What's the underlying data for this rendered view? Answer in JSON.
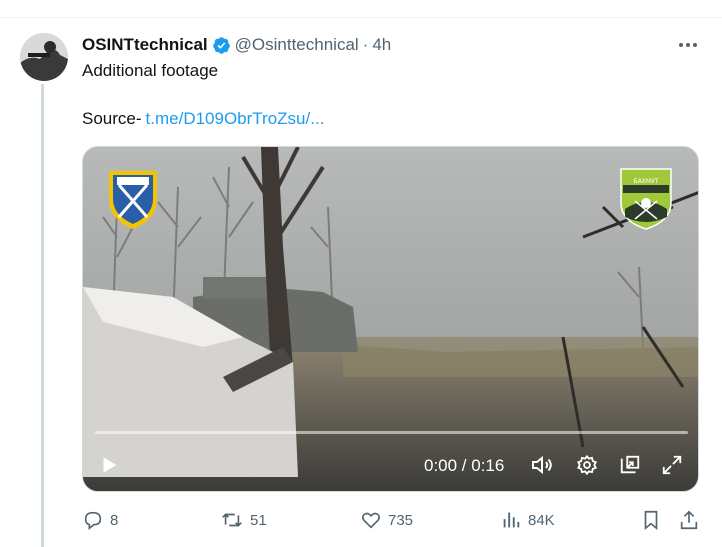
{
  "tweet": {
    "display_name": "OSINTtechnical",
    "handle": "@Osinttechnical",
    "separator": "·",
    "time": "4h",
    "text": "Additional footage",
    "source_label": "Source-",
    "source_link": "t.me/D109ObrTroZsu/...",
    "verified_color": "#1d9bf0"
  },
  "media": {
    "timecode": "0:00 / 0:16",
    "badge_right_text": "БАХМУТ"
  },
  "actions": {
    "replies": "8",
    "reposts": "51",
    "likes": "735",
    "views": "84K"
  },
  "icons": {
    "verified": "verified-badge-icon",
    "more": "more-dots-icon",
    "play": "play-icon",
    "volume": "volume-icon",
    "settings": "gear-icon",
    "popout": "popout-icon",
    "fullscreen": "fullscreen-icon",
    "reply": "reply-icon",
    "repost": "repost-icon",
    "like": "heart-icon",
    "views": "views-icon",
    "bookmark": "bookmark-icon",
    "share": "share-icon"
  }
}
